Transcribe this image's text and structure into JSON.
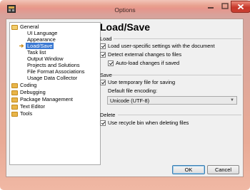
{
  "window": {
    "title": "Options"
  },
  "tree": {
    "items": [
      {
        "label": "General",
        "level": 0,
        "icon": "folder-open-icon"
      },
      {
        "label": "UI Language",
        "level": 1
      },
      {
        "label": "Appearance",
        "level": 1
      },
      {
        "label": "Load/Save",
        "level": 1,
        "selected": true
      },
      {
        "label": "Task list",
        "level": 1
      },
      {
        "label": "Output Window",
        "level": 1
      },
      {
        "label": "Projects and Solutions",
        "level": 1
      },
      {
        "label": "File Format Associations",
        "level": 1
      },
      {
        "label": "Usage Data Collector",
        "level": 1
      },
      {
        "label": "Coding",
        "level": 0,
        "icon": "folder-icon"
      },
      {
        "label": "Debugging",
        "level": 0,
        "icon": "folder-icon"
      },
      {
        "label": "Package Management",
        "level": 0,
        "icon": "folder-icon"
      },
      {
        "label": "Text Editor",
        "level": 0,
        "icon": "folder-icon"
      },
      {
        "label": "Tools",
        "level": 0,
        "icon": "folder-icon"
      }
    ]
  },
  "page": {
    "heading": "Load/Save",
    "load": {
      "title": "Load",
      "use_user_settings": "Load user-specific settings with the document",
      "detect_changes": "Detect external changes to files",
      "auto_load": "Auto-load changes if saved"
    },
    "save": {
      "title": "Save",
      "use_temp": "Use temporary file for saving",
      "encoding_label": "Default file encoding:",
      "encoding_value": "Unicode (UTF-8)"
    },
    "delete": {
      "title": "Delete",
      "recycle_bin": "Use recycle bin when deleting files"
    }
  },
  "buttons": {
    "ok": "OK",
    "cancel": "Cancel"
  },
  "colors": {
    "selection": "#3a78d2",
    "folder": "#e8b54a",
    "close": "#c8382b"
  }
}
